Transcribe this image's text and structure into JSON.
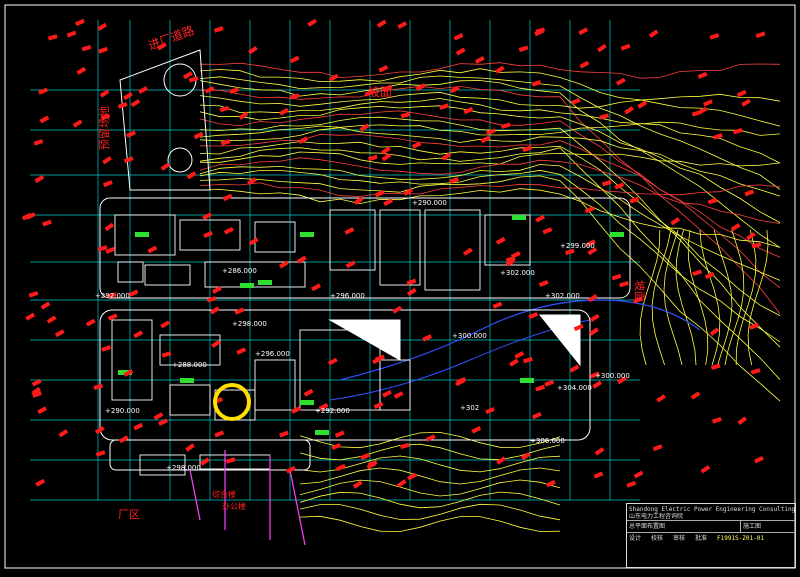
{
  "drawing": {
    "area_labels": {
      "north_slope": "坡面",
      "east_slope": "坡面",
      "west_label": "预留场地",
      "south_label": "厂区",
      "top_label": "进厂道路",
      "south_mid_1": "综合楼",
      "south_mid_2": "办公楼"
    },
    "elevations": [
      "+286.000",
      "+290.000",
      "+292.000",
      "+296.000",
      "+298.000",
      "+300.000",
      "+302.000",
      "+302.000",
      "+304.000",
      "+306.000",
      "+298.000",
      "+300.000",
      "+296.000",
      "+292.000",
      "+288.000",
      "+302",
      "+299.000",
      "+290.000"
    ],
    "title_block": {
      "company_en": "Shandong Electric Power Engineering Consulting Institute",
      "company_cn": "山东电力工程咨询院",
      "project": "总平面布置图",
      "sheet_label": "施工图",
      "drawing_no": "F1991S-Z01-01",
      "row_labels": [
        "设计",
        "校核",
        "审核",
        "批准"
      ]
    }
  }
}
